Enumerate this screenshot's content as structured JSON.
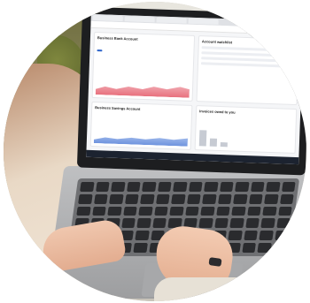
{
  "image": {
    "subject": "Person typing on a laptop showing a banking dashboard",
    "screen": {
      "cards": [
        {
          "title": "Business Bank Account",
          "button": ""
        },
        {
          "title": "Account watchlist"
        },
        {
          "title": "Business Savings Account"
        },
        {
          "title": "Invoices owed to you"
        }
      ]
    }
  }
}
